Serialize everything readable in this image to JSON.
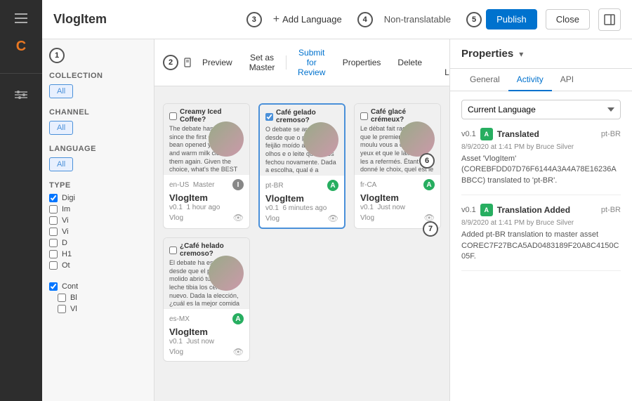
{
  "header": {
    "title": "VlogItem",
    "add_language_label": "Add Language",
    "non_translatable_label": "Non-translatable",
    "publish_label": "Publish",
    "close_label": "Close",
    "callouts": {
      "add_language": "3",
      "non_translatable": "4",
      "publish": "5"
    }
  },
  "toolbar": {
    "preview_label": "Preview",
    "set_master_label": "Set as Master",
    "submit_label": "Submit for Review",
    "properties_label": "Properties",
    "delete_label": "Delete",
    "show_languages_label": "Show Existing Languages",
    "callout2": "2"
  },
  "filters": {
    "collection_label": "Collection",
    "channel_label": "Channel",
    "language_label": "Language",
    "type_label": "Type",
    "all_label": "All",
    "callout1": "1",
    "type_items": [
      {
        "label": "Digi",
        "checked": true
      },
      {
        "label": "Im",
        "checked": false
      },
      {
        "label": "Vi",
        "checked": false
      },
      {
        "label": "Vi",
        "checked": false
      },
      {
        "label": "D",
        "checked": false
      },
      {
        "label": "H1",
        "checked": false
      },
      {
        "label": "Ot",
        "checked": false
      }
    ],
    "cont_items": [
      {
        "label": "Bl",
        "checked": false
      },
      {
        "label": "Vl",
        "checked": false
      }
    ]
  },
  "cards": [
    {
      "id": "en-US",
      "lang": "en-US  Master",
      "badge": "I",
      "badge_type": "i",
      "checkbox_label": "Creamy Iced Coffee?",
      "checked": false,
      "text": "The debate has raged since the first ground bean opened your eyes and warm milk closed them again. Given the choice, what's the BEST comfort food? Now, science has provided the answer. A new study from Jerry Ben Haagen | University was published recently.",
      "title": "VlogItem",
      "version": "v0.1",
      "time_ago": "1 hour ago",
      "type": "Vlog",
      "callout6": ""
    },
    {
      "id": "pt-BR",
      "lang": "pt-BR",
      "badge": "A",
      "badge_type": "a",
      "checkbox_label": "Café gelado cremoso?",
      "checked": true,
      "text": "O debate se arrasta desde que o primeiro feijão moído abriu seus olhos e o leite quente os fechou novamente. Dada a escolha, qual é a melhor comida de conforto? Agora, a ciência forneceu a resposta. Um novo estudo da Universidade Jerry Ben Haagen",
      "title": "VlogItem",
      "version": "v0.1",
      "time_ago": "6 minutes ago",
      "type": "Vlog",
      "active": true
    },
    {
      "id": "fr-CA",
      "lang": "fr-CA",
      "badge": "A",
      "badge_type": "a",
      "checkbox_label": "Café glacé crémeux?",
      "checked": false,
      "text": "Le débat fait rage depuis que le premier haricot moulu vous a ouvert les yeux et que le lait chaud les a refermés. Étant donné le choix, quel est le meilleur aliment de confort? Maintenant, la science a fourni la réponse. Une nouvelle étude de l'Université Jerry",
      "title": "VlogItem",
      "version": "v0.1",
      "time_ago": "Just now",
      "type": "Vlog",
      "callout7": "7"
    },
    {
      "id": "es-MX",
      "lang": "es-MX",
      "badge": "A",
      "badge_type": "a",
      "checkbox_label": "¿Café helado cremoso?",
      "checked": false,
      "text": "El debate ha estallado desde que el primer frijol molido abrió tus ojos y la leche tibia los cerró de nuevo. Dada la elección, ¿cuál es la mejor comida de confort? Ahora, la ciencia ha proporcionado la respuesta. Un nuevo estudio de la",
      "title": "VlogItem",
      "version": "v0.1",
      "time_ago": "Just now",
      "type": "Vlog"
    }
  ],
  "properties": {
    "title": "Properties",
    "tabs": [
      {
        "label": "General",
        "active": false
      },
      {
        "label": "Activity",
        "active": true
      },
      {
        "label": "API",
        "active": false
      }
    ],
    "language_select": "Current Language",
    "activity_items": [
      {
        "version": "v0.1",
        "badge": "A",
        "status": "Translated",
        "lang": "pt-BR",
        "time": "8/9/2020 at 1:41 PM by Bruce Silver",
        "desc": "Asset 'VlogItem' (COREBFDD07D76F6144A3A4A78E16236A BBCC) translated to 'pt-BR'."
      },
      {
        "version": "v0.1",
        "badge": "A",
        "status": "Translation Added",
        "lang": "pt-BR",
        "time": "8/9/2020 at 1:41 PM by Bruce Silver",
        "desc": "Added pt-BR translation to master asset COREC7F27BCA5AD0483189F20A8C4150C 05F."
      }
    ]
  }
}
